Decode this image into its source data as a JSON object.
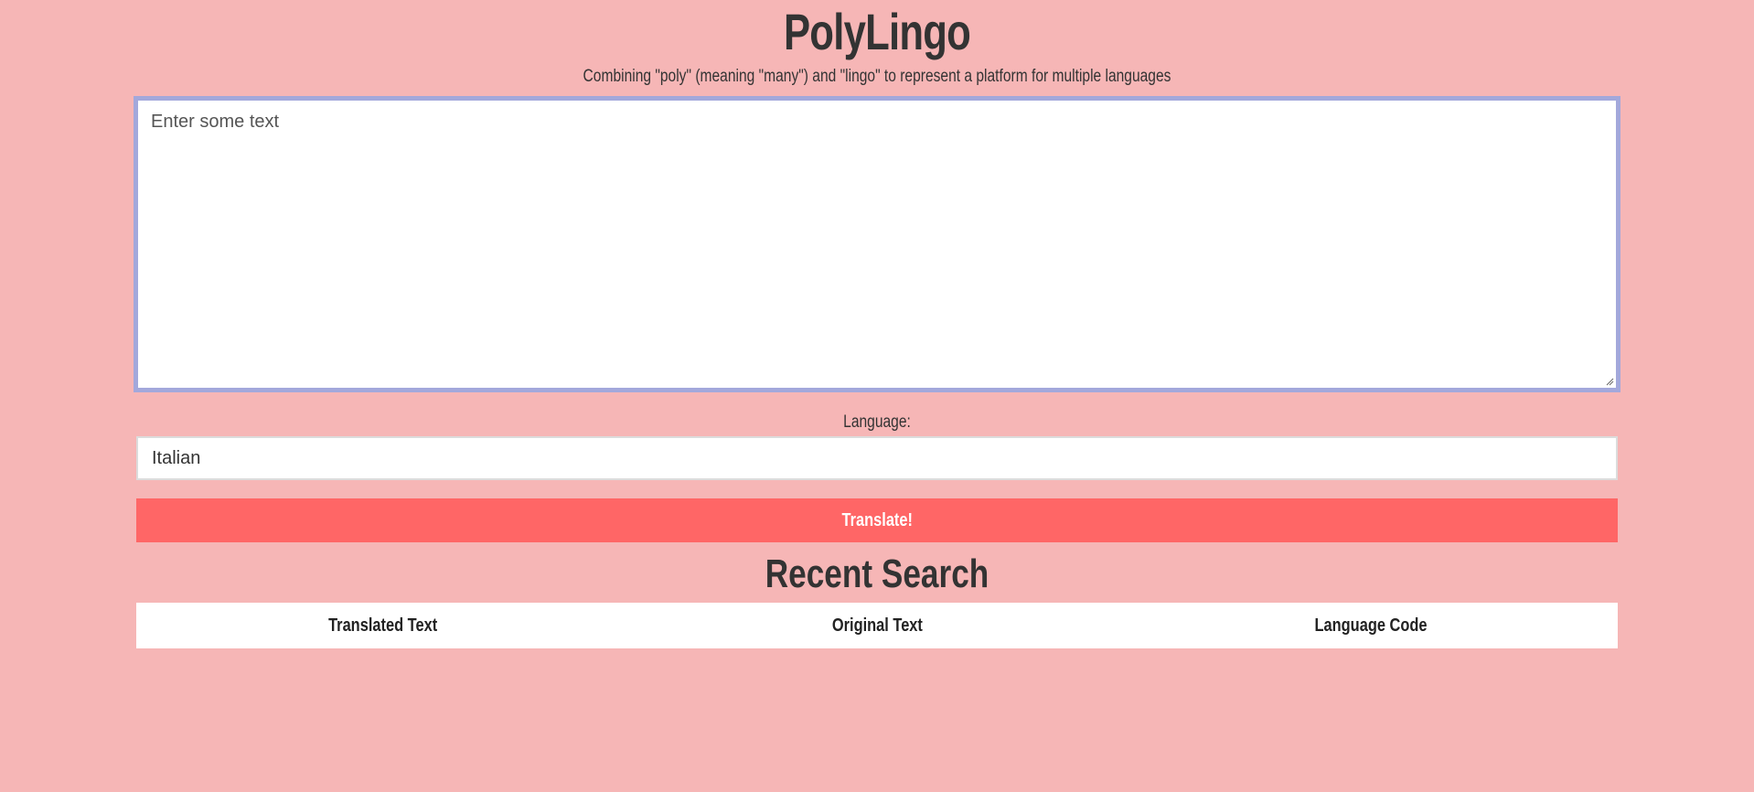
{
  "app": {
    "title": "PolyLingo",
    "subtitle": "Combining \"poly\" (meaning \"many\") and \"lingo\" to represent a platform for multiple languages"
  },
  "input": {
    "placeholder": "Enter some text",
    "value": ""
  },
  "language": {
    "label": "Language:",
    "value": "Italian"
  },
  "actions": {
    "translate_label": "Translate!"
  },
  "recent": {
    "title": "Recent Search",
    "columns": [
      "Translated Text",
      "Original Text",
      "Language Code"
    ]
  },
  "colors": {
    "background": "#f6b6b6",
    "button": "#ff6666",
    "focus_border": "#a3a8db"
  }
}
